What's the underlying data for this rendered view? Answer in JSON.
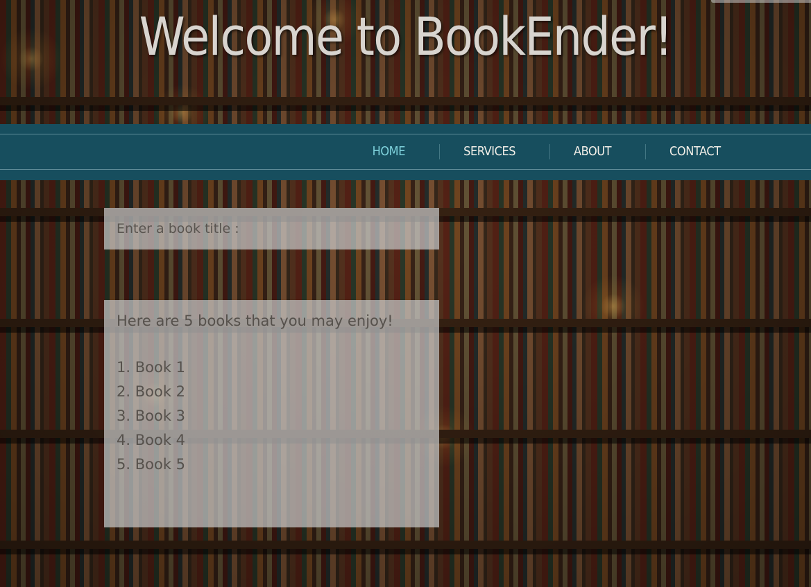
{
  "header": {
    "title": "Welcome to BookEnder!"
  },
  "nav": {
    "items": [
      {
        "label": "HOME",
        "active": true
      },
      {
        "label": "SERVICES",
        "active": false
      },
      {
        "label": "ABOUT",
        "active": false
      },
      {
        "label": "CONTACT",
        "active": false
      }
    ]
  },
  "search": {
    "placeholder": "Enter a book title :"
  },
  "recommendations": {
    "heading": "Here are 5 books that you may enjoy!",
    "books": [
      "1. Book 1",
      "2. Book 2",
      "3. Book 3",
      "4. Book 4",
      "5. Book 5"
    ]
  },
  "colors": {
    "nav_background": "#174e5e",
    "nav_active": "#7fd2dc",
    "nav_text": "#f2efe8",
    "title_text": "#d8d4cf",
    "panel_background": "#c8c8c8"
  }
}
